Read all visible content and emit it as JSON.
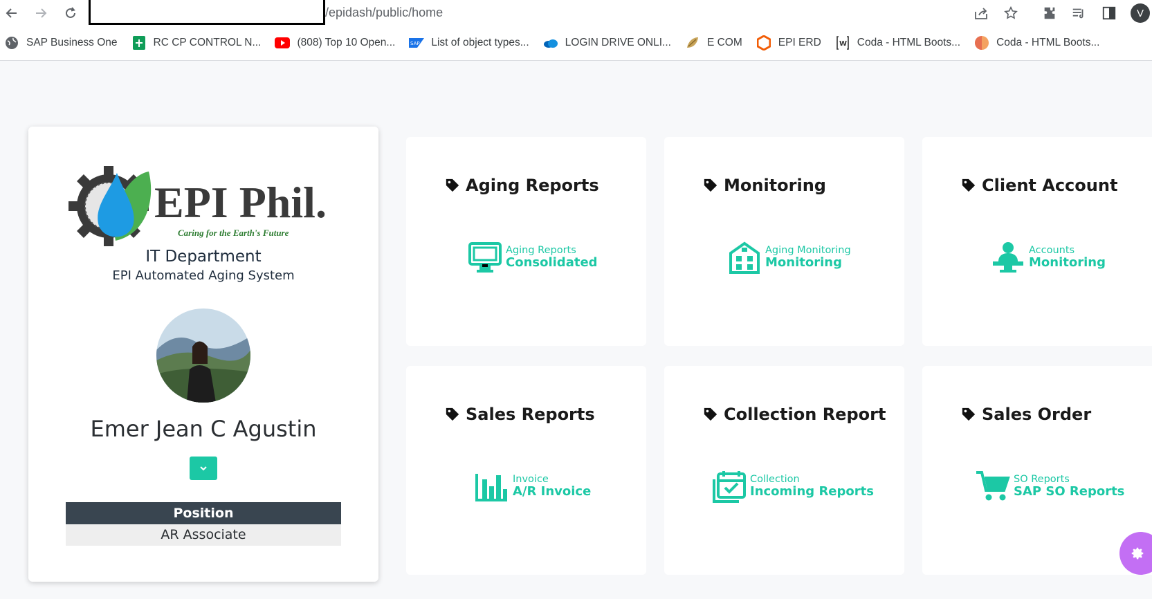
{
  "browser": {
    "url_path": "/epidash/public/home",
    "avatar_letter": "V",
    "bookmarks": [
      {
        "label": "SAP Business One",
        "icon": "globe-icon"
      },
      {
        "label": "RC CP CONTROL N...",
        "icon": "sheets-icon"
      },
      {
        "label": "(808) Top 10 Open...",
        "icon": "youtube-icon"
      },
      {
        "label": "List of object types...",
        "icon": "sap-icon"
      },
      {
        "label": "LOGIN DRIVE ONLI...",
        "icon": "onedrive-icon"
      },
      {
        "label": "E COM",
        "icon": "ecom-icon"
      },
      {
        "label": "EPI ERD",
        "icon": "epi-erd-icon"
      },
      {
        "label": "Coda - HTML Boots...",
        "icon": "coda-w-icon"
      },
      {
        "label": "Coda - HTML Boots...",
        "icon": "coda-orange-icon"
      }
    ]
  },
  "profile": {
    "logo_text": "EPI Phil.",
    "logo_tagline": "Caring for the Earth's Future",
    "department": "IT Department",
    "system_name": "EPI Automated Aging System",
    "user_name": "Emer Jean C Agustin",
    "position_header": "Position",
    "position_value": "AR Associate"
  },
  "tiles": [
    {
      "title": "Aging Reports",
      "small": "Aging Reports",
      "big": "Consolidated",
      "icon": "monitor-icon"
    },
    {
      "title": "Monitoring",
      "small": "Aging Monitoring",
      "big": "Monitoring",
      "icon": "building-icon"
    },
    {
      "title": "Client Account",
      "small": "Accounts",
      "big": "Monitoring",
      "icon": "user-desk-icon"
    },
    {
      "title": "Sales Reports",
      "small": "Invoice",
      "big": "A/R Invoice",
      "icon": "bar-chart-icon"
    },
    {
      "title": "Collection Report",
      "small": "Collection",
      "big": "Incoming Reports",
      "icon": "calendar-check-icon"
    },
    {
      "title": "Sales Order",
      "small": "SO Reports",
      "big": "SAP SO Reports",
      "icon": "cart-icon"
    }
  ],
  "colors": {
    "accent": "#1cc8a5",
    "position_header_bg": "#394550",
    "fab": "#c36ff4"
  }
}
